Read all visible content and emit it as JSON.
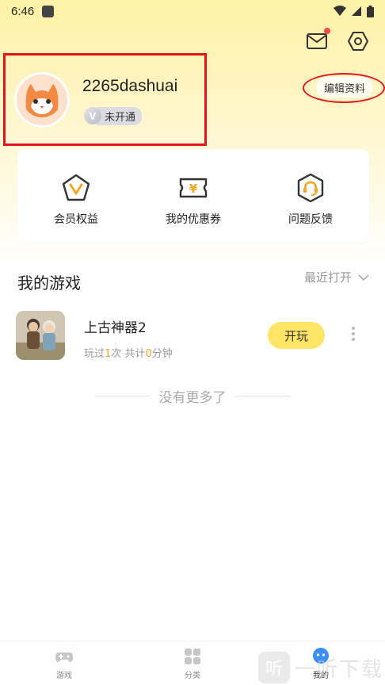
{
  "status_bar": {
    "time": "6:46"
  },
  "header": {
    "icons": [
      "mail-icon",
      "settings-icon"
    ]
  },
  "profile": {
    "username": "2265dashuai",
    "vip_letter": "V",
    "vip_status": "未开通",
    "edit_button": "编辑资料"
  },
  "quick_actions": [
    {
      "label": "会员权益",
      "icon": "vip-pentagon-icon",
      "color": "#f5a623"
    },
    {
      "label": "我的优惠券",
      "icon": "coupon-icon",
      "color": "#f5a623",
      "glyph": "¥"
    },
    {
      "label": "问题反馈",
      "icon": "headset-feedback-icon",
      "color": "#f5a623"
    }
  ],
  "my_games": {
    "title": "我的游戏",
    "sort_label": "最近打开",
    "games": [
      {
        "name": "上古神器2",
        "stats_prefix": "玩过",
        "play_count": "1",
        "stats_middle": "次 共计",
        "minutes": "0",
        "stats_suffix": "分钟",
        "play_button": "开玩"
      }
    ],
    "end_text": "没有更多了"
  },
  "tabbar": {
    "tabs": [
      {
        "label": "游戏",
        "icon": "gamepad-icon"
      },
      {
        "label": "分类",
        "icon": "category-grid-icon"
      },
      {
        "label": "我的",
        "icon": "profile-bubble-icon",
        "active": true
      }
    ]
  },
  "watermark": {
    "glyph": "听",
    "text": "一听下载"
  },
  "colors": {
    "accent": "#ffe566",
    "highlight": "#f5a623",
    "annotation_red": "#e4141c"
  }
}
